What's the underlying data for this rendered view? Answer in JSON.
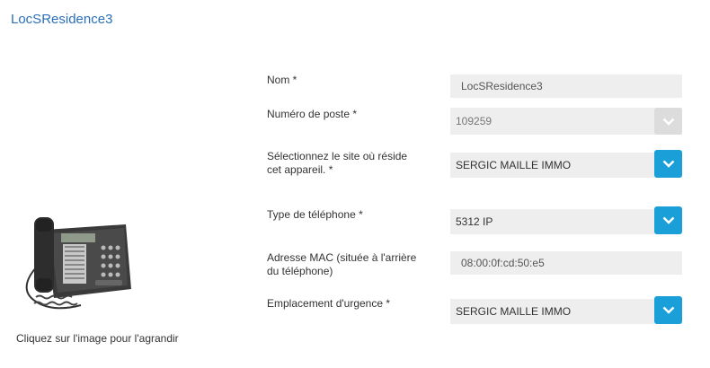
{
  "header": {
    "title": "LocSResidence3"
  },
  "image": {
    "caption": "Cliquez sur l'image pour l'agrandir",
    "icon": "desk-phone-image"
  },
  "form": {
    "name": {
      "label": "Nom  *",
      "value": "LocSResidence3"
    },
    "extension": {
      "label": "Numéro de poste  *",
      "value": "109259"
    },
    "site": {
      "label_line1": "Sélectionnez le site où réside",
      "label_line2": "cet appareil.  *",
      "value": "SERGIC MAILLE IMMO"
    },
    "phone_type": {
      "label": "Type de téléphone  *",
      "value": "5312 IP"
    },
    "mac": {
      "label_line1": "Adresse MAC (située à l'arrière",
      "label_line2": "du téléphone)",
      "value": "08:00:0f:cd:50:e5"
    },
    "emergency": {
      "label": "Emplacement d'urgence  *",
      "value": "SERGIC MAILLE IMMO"
    }
  },
  "colors": {
    "accent": "#1a9fd9",
    "title": "#2a6fb8",
    "field_bg": "#eeeeee"
  }
}
